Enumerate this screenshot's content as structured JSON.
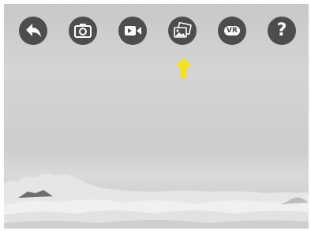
{
  "toolbar": {
    "buttons": [
      {
        "name": "back-button",
        "icon": "back-arrow-icon"
      },
      {
        "name": "camera-button",
        "icon": "camera-icon"
      },
      {
        "name": "video-button",
        "icon": "video-camera-icon"
      },
      {
        "name": "gallery-button",
        "icon": "photos-icon"
      },
      {
        "name": "vr-button",
        "icon": "vr-icon",
        "label": "VR"
      },
      {
        "name": "help-button",
        "icon": "question-icon",
        "label": "?"
      }
    ],
    "button_color": "#4d4d4d",
    "glyph_color": "#ffffff"
  },
  "highlight": {
    "icon": "up-arrow-indicator",
    "color": "#f5e31a",
    "target": "gallery-button"
  },
  "scene": {
    "description_icon": "sky-cloudscape",
    "tone": "grayscale"
  }
}
